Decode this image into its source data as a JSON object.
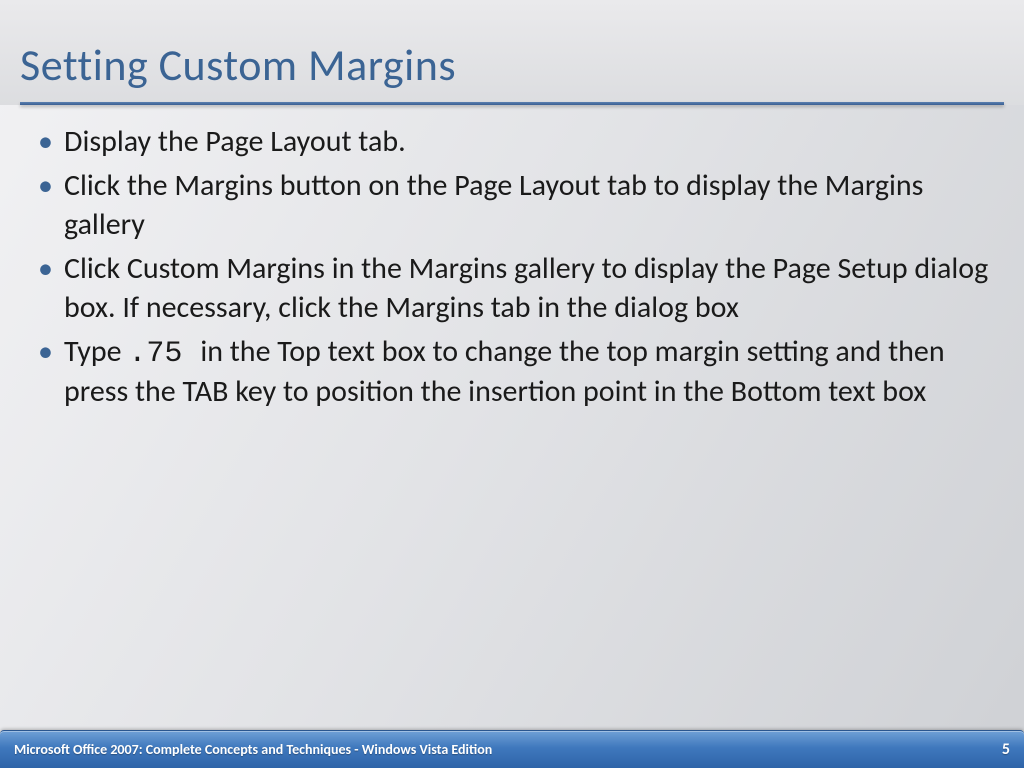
{
  "slide": {
    "title": "Setting Custom Margins",
    "bullets": [
      {
        "pre": "Display the Page Layout tab.",
        "mono": "",
        "post": ""
      },
      {
        "pre": "Click the Margins button on the Page Layout tab to display the Margins gallery",
        "mono": "",
        "post": ""
      },
      {
        "pre": "Click Custom Margins in the Margins gallery to display the Page Setup dialog box. If necessary, click the Margins tab in the dialog box",
        "mono": "",
        "post": ""
      },
      {
        "pre": "Type ",
        "mono": ".75 ",
        "post": " in the Top text box to change the top margin setting and then press the TAB key to position the insertion point in the Bottom text box"
      }
    ]
  },
  "footer": {
    "left": "Microsoft Office 2007: Complete Concepts and Techniques - Windows Vista Edition",
    "page": "5"
  }
}
